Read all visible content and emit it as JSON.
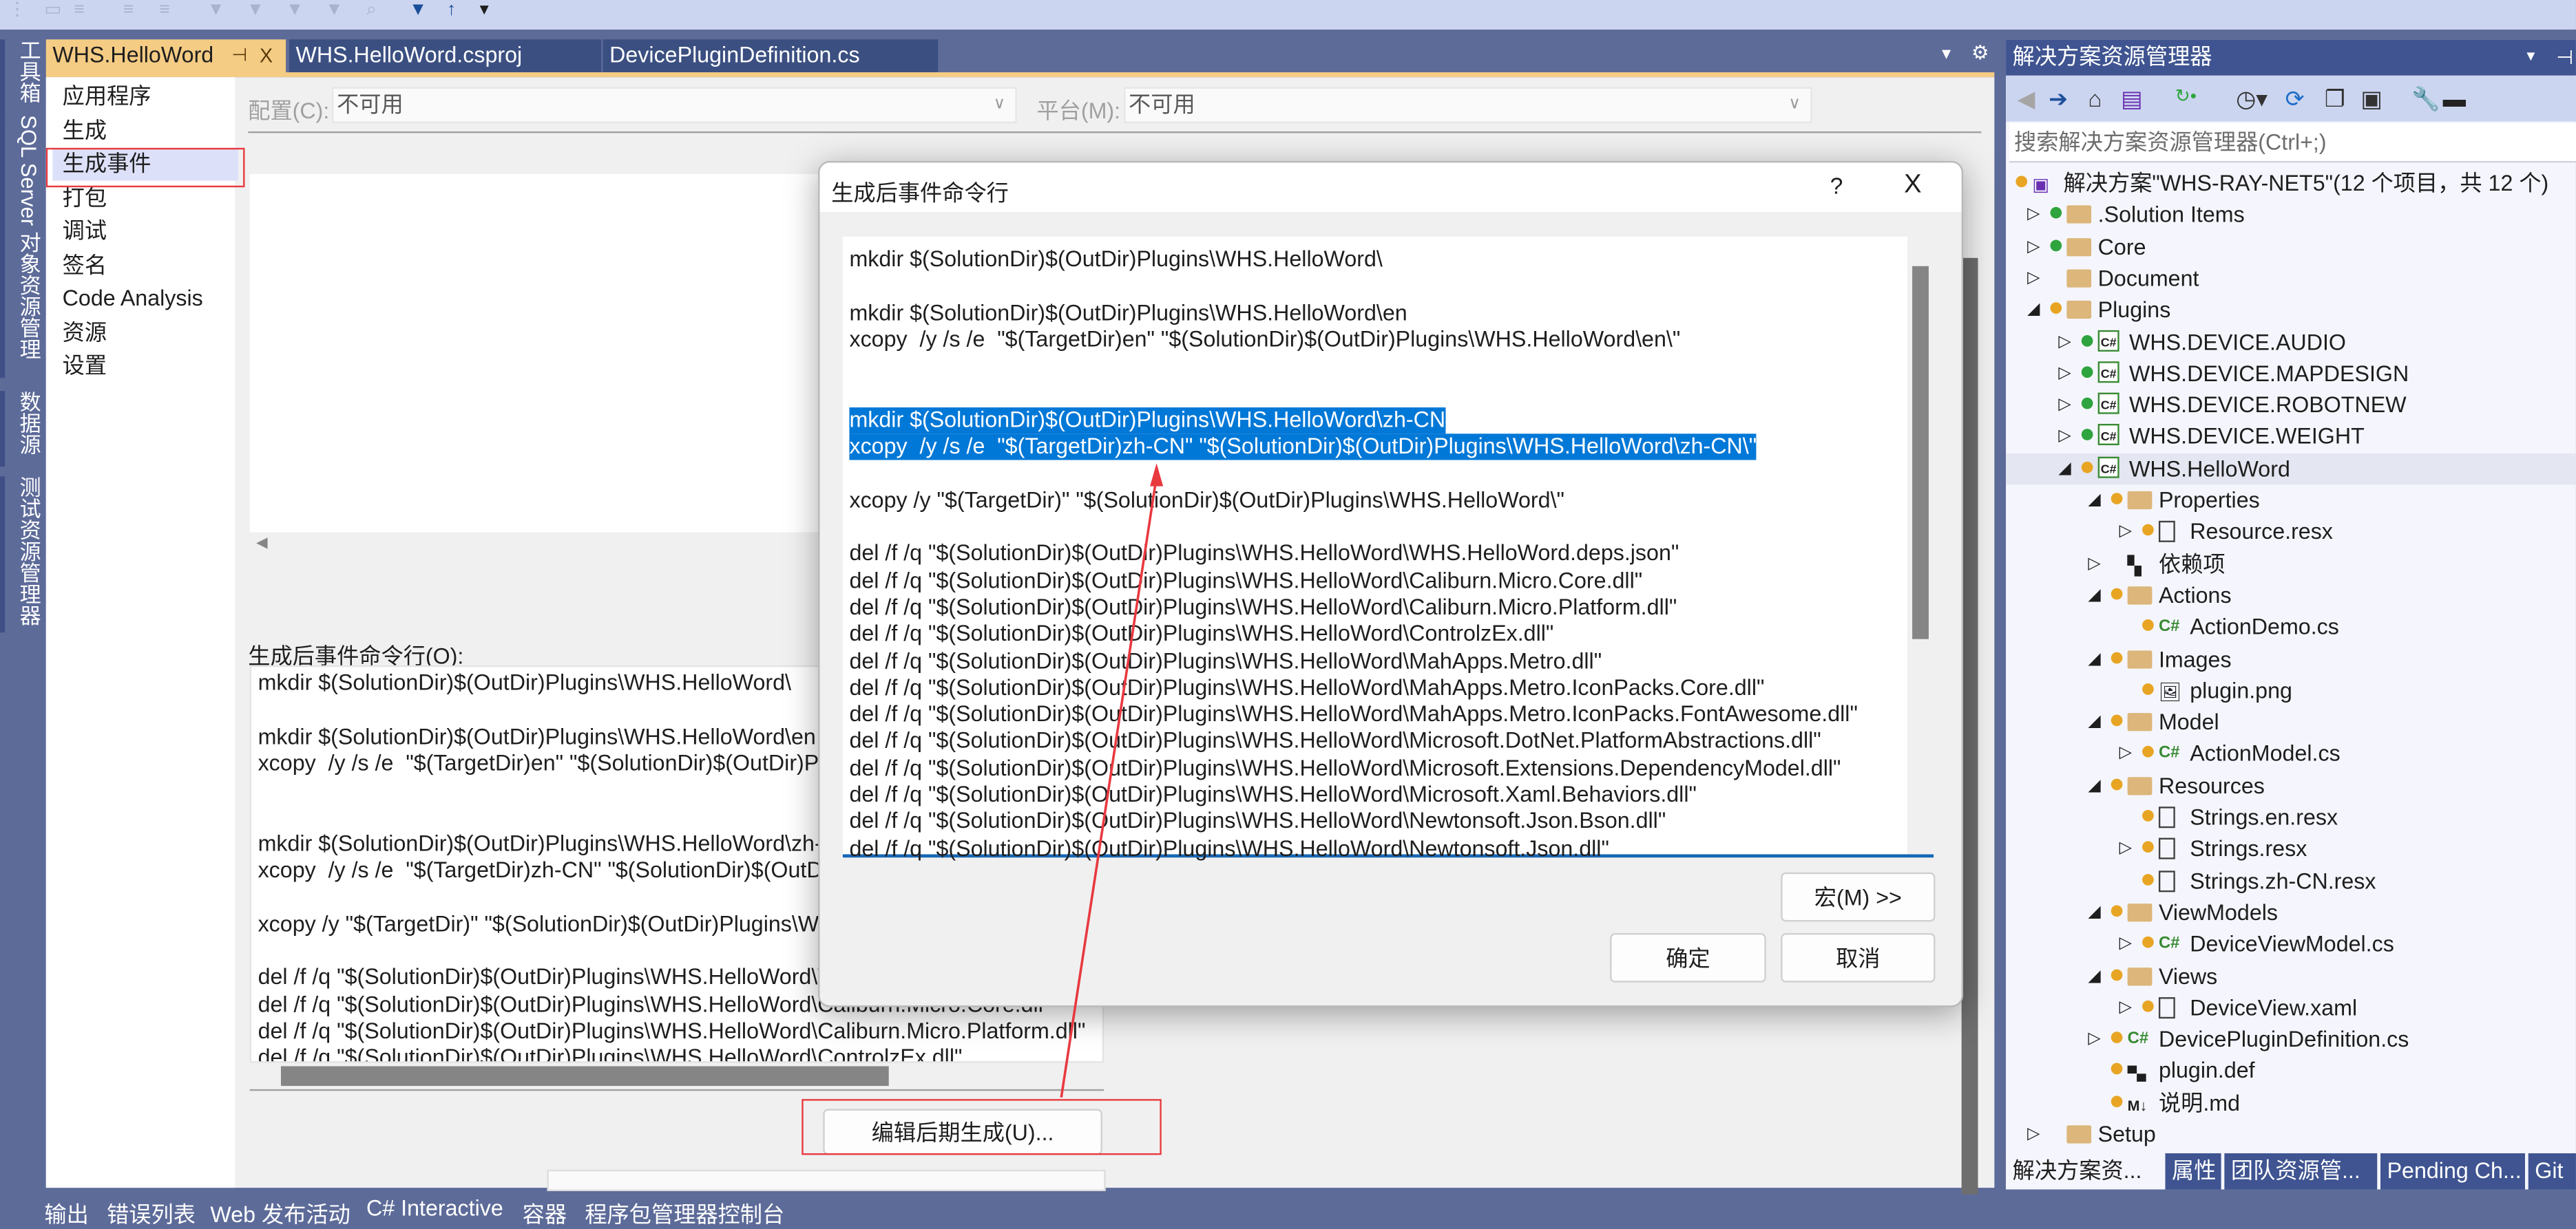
{
  "toolbar": {
    "icons": [
      "grip-icon",
      "comment-icon",
      "uncomment-icon",
      "indent-icon",
      "outdent-icon",
      "bookmark-icon",
      "prev-bookmark-icon",
      "next-bookmark-icon",
      "clear-bookmark-icon",
      "find-icon",
      "down-arrow-icon",
      "up-arrow-icon",
      "overflow-icon"
    ]
  },
  "left_tool_tabs": [
    "工具箱",
    "SQL Server 对象资源管理器",
    "数据源",
    "测试资源管理器"
  ],
  "doc_tabs": [
    {
      "label": "WHS.HelloWord",
      "active": true
    },
    {
      "label": "WHS.HelloWord.csproj",
      "active": false
    },
    {
      "label": "DevicePluginDefinition.cs",
      "active": false
    }
  ],
  "tab_actions": {
    "pin": "⊣",
    "close": "X",
    "dropdown": "▾",
    "settings": "⚙"
  },
  "prop_nav": {
    "items": [
      "应用程序",
      "生成",
      "生成事件",
      "打包",
      "调试",
      "签名",
      "Code Analysis",
      "资源",
      "设置"
    ],
    "selected": "生成事件"
  },
  "config": {
    "label": "配置(C):",
    "value": "不可用"
  },
  "platform": {
    "label": "平台(M):",
    "value": "不可用"
  },
  "post_build": {
    "label": "生成后事件命令行(O):",
    "lines": [
      "mkdir $(SolutionDir)$(OutDir)Plugins\\WHS.HelloWord\\",
      "",
      "mkdir $(SolutionDir)$(OutDir)Plugins\\WHS.HelloWord\\en",
      "xcopy  /y /s /e  \"$(TargetDir)en\" \"$(SolutionDir)$(OutDir)Plugins\\WHS.HelloWord\\en\\\"",
      "",
      "",
      "mkdir $(SolutionDir)$(OutDir)Plugins\\WHS.HelloWord\\zh-CN",
      "xcopy  /y /s /e  \"$(TargetDir)zh-CN\" \"$(SolutionDir)$(OutDir)Plugins\\WHS.HelloWord\\zh-CN\\\"",
      "",
      "xcopy /y \"$(TargetDir)\" \"$(SolutionDir)$(OutDir)Plugins\\WHS.HelloWord\\\"",
      "",
      "del /f /q \"$(SolutionDir)$(OutDir)Plugins\\WHS.HelloWord\\WHS.HelloWord.deps.json\"",
      "del /f /q \"$(SolutionDir)$(OutDir)Plugins\\WHS.HelloWord\\Caliburn.Micro.Core.dll\"",
      "del /f /q \"$(SolutionDir)$(OutDir)Plugins\\WHS.HelloWord\\Caliburn.Micro.Platform.dll\"",
      "del /f /q \"$(SolutionDir)$(OutDir)Plugins\\WHS.HelloWord\\ControlzEx.dll\""
    ],
    "edit_button": "编辑后期生成(U)..."
  },
  "dialog": {
    "title": "生成后事件命令行",
    "help": "?",
    "close": "X",
    "lines": [
      {
        "text": "mkdir $(SolutionDir)$(OutDir)Plugins\\WHS.HelloWord\\",
        "selected": false
      },
      {
        "text": "",
        "selected": false
      },
      {
        "text": "mkdir $(SolutionDir)$(OutDir)Plugins\\WHS.HelloWord\\en",
        "selected": false
      },
      {
        "text": "xcopy  /y /s /e  \"$(TargetDir)en\" \"$(SolutionDir)$(OutDir)Plugins\\WHS.HelloWord\\en\\\"",
        "selected": false
      },
      {
        "text": "",
        "selected": false
      },
      {
        "text": "",
        "selected": false
      },
      {
        "text": "mkdir $(SolutionDir)$(OutDir)Plugins\\WHS.HelloWord\\zh-CN",
        "selected": true
      },
      {
        "text": "xcopy  /y /s /e  \"$(TargetDir)zh-CN\" \"$(SolutionDir)$(OutDir)Plugins\\WHS.HelloWord\\zh-CN\\\"",
        "selected": true
      },
      {
        "text": "",
        "selected": false
      },
      {
        "text": "xcopy /y \"$(TargetDir)\" \"$(SolutionDir)$(OutDir)Plugins\\WHS.HelloWord\\\"",
        "selected": false
      },
      {
        "text": "",
        "selected": false
      },
      {
        "text": "del /f /q \"$(SolutionDir)$(OutDir)Plugins\\WHS.HelloWord\\WHS.HelloWord.deps.json\"",
        "selected": false
      },
      {
        "text": "del /f /q \"$(SolutionDir)$(OutDir)Plugins\\WHS.HelloWord\\Caliburn.Micro.Core.dll\"",
        "selected": false
      },
      {
        "text": "del /f /q \"$(SolutionDir)$(OutDir)Plugins\\WHS.HelloWord\\Caliburn.Micro.Platform.dll\"",
        "selected": false
      },
      {
        "text": "del /f /q \"$(SolutionDir)$(OutDir)Plugins\\WHS.HelloWord\\ControlzEx.dll\"",
        "selected": false
      },
      {
        "text": "del /f /q \"$(SolutionDir)$(OutDir)Plugins\\WHS.HelloWord\\MahApps.Metro.dll\"",
        "selected": false
      },
      {
        "text": "del /f /q \"$(SolutionDir)$(OutDir)Plugins\\WHS.HelloWord\\MahApps.Metro.IconPacks.Core.dll\"",
        "selected": false
      },
      {
        "text": "del /f /q \"$(SolutionDir)$(OutDir)Plugins\\WHS.HelloWord\\MahApps.Metro.IconPacks.FontAwesome.dll\"",
        "selected": false
      },
      {
        "text": "del /f /q \"$(SolutionDir)$(OutDir)Plugins\\WHS.HelloWord\\Microsoft.DotNet.PlatformAbstractions.dll\"",
        "selected": false
      },
      {
        "text": "del /f /q \"$(SolutionDir)$(OutDir)Plugins\\WHS.HelloWord\\Microsoft.Extensions.DependencyModel.dll\"",
        "selected": false
      },
      {
        "text": "del /f /q \"$(SolutionDir)$(OutDir)Plugins\\WHS.HelloWord\\Microsoft.Xaml.Behaviors.dll\"",
        "selected": false
      },
      {
        "text": "del /f /q \"$(SolutionDir)$(OutDir)Plugins\\WHS.HelloWord\\Newtonsoft.Json.Bson.dll\"",
        "selected": false
      },
      {
        "text": "del /f /q \"$(SolutionDir)$(OutDir)Plugins\\WHS.HelloWord\\Newtonsoft.Json.dll\"",
        "selected": false
      }
    ],
    "macro_button": "宏(M) >>",
    "ok_button": "确定",
    "cancel_button": "取消"
  },
  "solution_explorer": {
    "title": "解决方案资源管理器",
    "search_placeholder": "搜索解决方案资源管理器(Ctrl+;)",
    "toolbar_icons": [
      "back-icon",
      "forward-icon",
      "home-icon",
      "vs-switch-views-icon",
      "pending-changes-filter-icon",
      "history-icon",
      "sync-icon",
      "collapse-all-icon",
      "show-all-files-icon",
      "properties-wrench-icon",
      "preview-icon"
    ],
    "tree": [
      {
        "label": "解决方案\"WHS-RAY-NET5\"(12 个项目，共 12 个)",
        "level": 0,
        "expander": "",
        "status": "orange",
        "icon": "solution"
      },
      {
        "label": ".Solution Items",
        "level": 1,
        "expander": "collapsed",
        "status": "green",
        "icon": "folder"
      },
      {
        "label": "Core",
        "level": 1,
        "expander": "collapsed",
        "status": "green",
        "icon": "folder"
      },
      {
        "label": "Document",
        "level": 1,
        "expander": "collapsed",
        "status": "",
        "icon": "folder"
      },
      {
        "label": "Plugins",
        "level": 1,
        "expander": "expanded",
        "status": "orange",
        "icon": "folder-open"
      },
      {
        "label": "WHS.DEVICE.AUDIO",
        "level": 2,
        "expander": "collapsed",
        "status": "green",
        "icon": "csproj"
      },
      {
        "label": "WHS.DEVICE.MAPDESIGN",
        "level": 2,
        "expander": "collapsed",
        "status": "green",
        "icon": "csproj"
      },
      {
        "label": "WHS.DEVICE.ROBOTNEW",
        "level": 2,
        "expander": "collapsed",
        "status": "green",
        "icon": "csproj"
      },
      {
        "label": "WHS.DEVICE.WEIGHT",
        "level": 2,
        "expander": "collapsed",
        "status": "green",
        "icon": "csproj"
      },
      {
        "label": "WHS.HelloWord",
        "level": 2,
        "expander": "expanded",
        "status": "orange",
        "icon": "csproj",
        "highlighted": true
      },
      {
        "label": "Properties",
        "level": 3,
        "expander": "expanded",
        "status": "orange",
        "icon": "folder-props"
      },
      {
        "label": "Resource.resx",
        "level": 4,
        "expander": "collapsed",
        "status": "orange",
        "icon": "doc"
      },
      {
        "label": "依赖项",
        "level": 3,
        "expander": "collapsed",
        "status": "",
        "icon": "deps"
      },
      {
        "label": "Actions",
        "level": 3,
        "expander": "expanded",
        "status": "orange",
        "icon": "folder-open"
      },
      {
        "label": "ActionDemo.cs",
        "level": 4,
        "expander": "",
        "status": "orange",
        "icon": "cs"
      },
      {
        "label": "Images",
        "level": 3,
        "expander": "expanded",
        "status": "orange",
        "icon": "folder-open"
      },
      {
        "label": "plugin.png",
        "level": 4,
        "expander": "",
        "status": "orange",
        "icon": "image"
      },
      {
        "label": "Model",
        "level": 3,
        "expander": "expanded",
        "status": "orange",
        "icon": "folder-open"
      },
      {
        "label": "ActionModel.cs",
        "level": 4,
        "expander": "collapsed",
        "status": "orange",
        "icon": "cs"
      },
      {
        "label": "Resources",
        "level": 3,
        "expander": "expanded",
        "status": "orange",
        "icon": "folder-open"
      },
      {
        "label": "Strings.en.resx",
        "level": 4,
        "expander": "",
        "status": "orange",
        "icon": "doc"
      },
      {
        "label": "Strings.resx",
        "level": 4,
        "expander": "collapsed",
        "status": "orange",
        "icon": "doc"
      },
      {
        "label": "Strings.zh-CN.resx",
        "level": 4,
        "expander": "",
        "status": "orange",
        "icon": "doc"
      },
      {
        "label": "ViewModels",
        "level": 3,
        "expander": "expanded",
        "status": "orange",
        "icon": "folder-open"
      },
      {
        "label": "DeviceViewModel.cs",
        "level": 4,
        "expander": "collapsed",
        "status": "orange",
        "icon": "cs"
      },
      {
        "label": "Views",
        "level": 3,
        "expander": "expanded",
        "status": "orange",
        "icon": "folder-open"
      },
      {
        "label": "DeviceView.xaml",
        "level": 4,
        "expander": "collapsed",
        "status": "orange",
        "icon": "xaml"
      },
      {
        "label": "DevicePluginDefinition.cs",
        "level": 3,
        "expander": "collapsed",
        "status": "orange",
        "icon": "cs"
      },
      {
        "label": "plugin.def",
        "level": 3,
        "expander": "",
        "status": "orange",
        "icon": "def"
      },
      {
        "label": "说明.md",
        "level": 3,
        "expander": "",
        "status": "orange",
        "icon": "md"
      },
      {
        "label": "Setup",
        "level": 1,
        "expander": "collapsed",
        "status": "",
        "icon": "folder"
      }
    ],
    "tabs": [
      {
        "label": "解决方案资...",
        "active": true
      },
      {
        "label": "属性",
        "active": false
      },
      {
        "label": "团队资源管...",
        "active": false
      },
      {
        "label": "Pending Ch...",
        "active": false
      },
      {
        "label": "Git",
        "active": false
      }
    ]
  },
  "bottom_tabs": [
    "输出",
    "错误列表",
    "Web 发布活动",
    "C# Interactive",
    "容器",
    "程序包管理器控制台"
  ],
  "colors": {
    "accent_tab": "#f5cc84",
    "chrome": "#5d6b99",
    "selection": "#0078d7",
    "annotation_red": "#e8393f"
  }
}
